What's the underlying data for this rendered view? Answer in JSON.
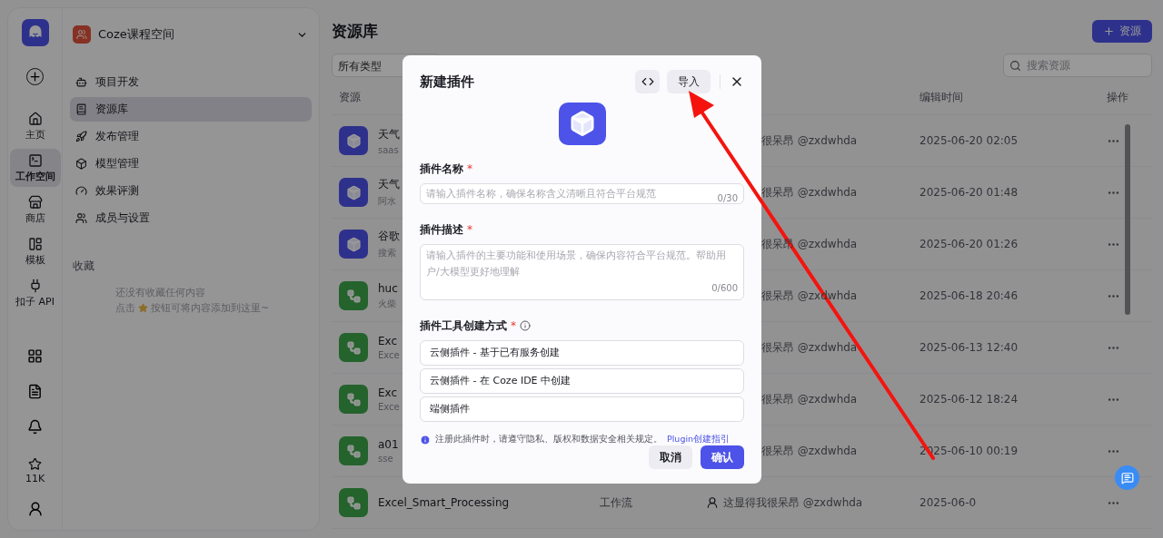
{
  "rail": {
    "items": [
      {
        "label": "主页",
        "selected": false
      },
      {
        "label": "工作空间",
        "selected": true
      },
      {
        "label": "商店",
        "selected": false
      },
      {
        "label": "模板",
        "selected": false
      },
      {
        "label": "扣子 API",
        "selected": false
      }
    ],
    "stars": "11K"
  },
  "sidebar": {
    "space": "Coze课程空间",
    "items": [
      {
        "label": "项目开发",
        "selected": false
      },
      {
        "label": "资源库",
        "selected": true
      },
      {
        "label": "发布管理",
        "selected": false
      },
      {
        "label": "模型管理",
        "selected": false
      },
      {
        "label": "效果评测",
        "selected": false
      },
      {
        "label": "成员与设置",
        "selected": false
      }
    ],
    "favorites_title": "收藏",
    "empty_line_1": "还没有收藏任何内容",
    "empty_line_2_before": "点击",
    "empty_line_2_after": "按钮可将内容添加到这里~"
  },
  "main": {
    "title": "资源库",
    "add_button": "资源",
    "filter": "所有类型",
    "search": {
      "placeholder": "搜索资源"
    },
    "columns": [
      "资源",
      "编辑时间",
      "操作"
    ],
    "rows": [
      {
        "kind": "plugin",
        "name": "天气",
        "sub": "saas",
        "creator": "很呆昂 @zxdwhda",
        "time": "2025-06-20 02:05"
      },
      {
        "kind": "plugin",
        "name": "天气",
        "sub": "阿水",
        "creator": "很呆昂 @zxdwhda",
        "time": "2025-06-20 01:48"
      },
      {
        "kind": "plugin",
        "name": "谷歌",
        "sub": "搜索",
        "creator": "很呆昂 @zxdwhda",
        "time": "2025-06-20 01:26"
      },
      {
        "kind": "workflow",
        "name": "huc",
        "sub": "火柴",
        "creator": "很呆昂 @zxdwhda",
        "time": "2025-06-18 20:46"
      },
      {
        "kind": "workflow",
        "name": "Exc",
        "sub": "Exce",
        "creator": "很呆昂 @zxdwhda",
        "time": "2025-06-13 12:40"
      },
      {
        "kind": "workflow",
        "name": "Exc",
        "sub": "Exce",
        "creator": "很呆昂 @zxdwhda",
        "time": "2025-06-12 18:24"
      },
      {
        "kind": "workflow",
        "name": "a01",
        "sub": "sse",
        "creator": "很呆昂 @zxdwhda",
        "time": "2025-06-10 00:19"
      },
      {
        "kind": "workflow",
        "name": "Excel_Smart_Processing",
        "type": "工作流",
        "avatar": true,
        "creator": "这显得我很呆昂 @zxdwhda",
        "time": "2025-06-0"
      }
    ]
  },
  "dialog": {
    "title": "新建插件",
    "import_button": "导入",
    "name_field": {
      "label": "插件名称",
      "mark": "*",
      "placeholder": "请输入插件名称，确保名称含义清晰且符合平台规范",
      "counter": "0/30"
    },
    "desc_field": {
      "label": "插件描述",
      "mark": "*",
      "placeholder": "请输入插件的主要功能和使用场景，确保内容符合平台规范。帮助用户/大模型更好地理解",
      "counter": "0/600"
    },
    "method": {
      "label": "插件工具创建方式",
      "mark": "*",
      "options": [
        {
          "label": "云侧插件 - 基于已有服务创建",
          "selected": false
        },
        {
          "label": "云侧插件 - 在 Coze IDE 中创建",
          "selected": false
        },
        {
          "label": "端侧插件",
          "selected": false
        }
      ]
    },
    "notice": "注册此插件时，请遵守隐私、版权和数据安全相关规定。",
    "notice_link": "Plugin创建指引",
    "cancel": "取消",
    "confirm": "确认"
  }
}
